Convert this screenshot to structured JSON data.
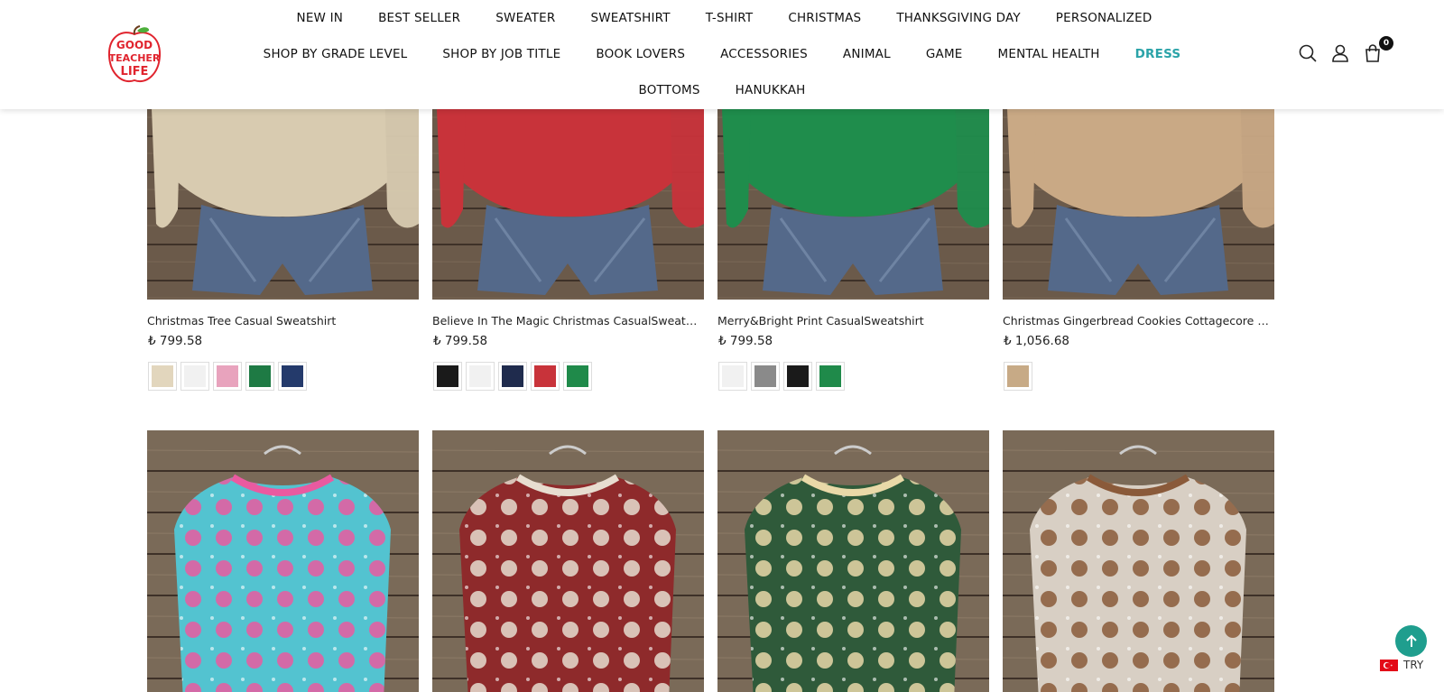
{
  "brand": {
    "logo_text": "GOOD TEACHER LIFE"
  },
  "nav": {
    "row1": [
      "NEW IN",
      "BEST SELLER",
      "SWEATER",
      "SWEATSHIRT",
      "T-SHIRT",
      "CHRISTMAS",
      "THANKSGIVING DAY",
      "PERSONALIZED"
    ],
    "row2": [
      "SHOP BY GRADE LEVEL",
      "SHOP BY JOB TITLE",
      "BOOK LOVERS",
      "ACCESSORIES",
      "ANIMAL",
      "GAME",
      "MENTAL HEALTH",
      "DRESS"
    ],
    "row3": [
      "BOTTOMS",
      "HANUKKAH"
    ],
    "active": "DRESS",
    "active_color": "#2aa3a8"
  },
  "cart": {
    "count": "0"
  },
  "products_row1": [
    {
      "title": "Christmas Tree Casual Sweatshirt",
      "price": "₺ 799.58",
      "sweater_color": "#d8cbb0",
      "swatches": [
        "#e2d6bd",
        "#f1f1f1",
        "#e8a3bd",
        "#1e7a44",
        "#243a6b"
      ]
    },
    {
      "title": "Believe In The Magic Christmas CasualSweats…",
      "price": "₺ 799.58",
      "sweater_color": "#c8333a",
      "swatches": [
        "#1a1a1a",
        "#f1f1f1",
        "#1f2b4d",
        "#c8333a",
        "#1f8a4a"
      ]
    },
    {
      "title": "Merry&Bright Print CasualSweatshirt",
      "price": "₺ 799.58",
      "sweater_color": "#1f8d4c",
      "swatches": [
        "#f1f1f1",
        "#8a8a8a",
        "#1a1a1a",
        "#1f8a4a"
      ]
    },
    {
      "title": "Christmas Gingerbread Cookies Cottagecore …",
      "price": "₺ 1,056.68",
      "sweater_color": "#c9a985",
      "swatches": [
        "#c7aa86"
      ]
    }
  ],
  "products_row2": [
    {
      "name": "pink-santa-sweater",
      "main": "#53c3d0",
      "accent": "#ea5aa0"
    },
    {
      "name": "santa-patchwork-sweater",
      "main": "#8e2a2b",
      "accent": "#e7ddd0"
    },
    {
      "name": "christmas-tree-sweater",
      "main": "#2f5a3a",
      "accent": "#e9d9a8"
    },
    {
      "name": "highland-cow-sweater",
      "main": "#d8cfc4",
      "accent": "#8a5a3a"
    }
  ],
  "currency": {
    "label": "TRY"
  },
  "colors": {
    "scroll_top": "#1f9e8e"
  }
}
